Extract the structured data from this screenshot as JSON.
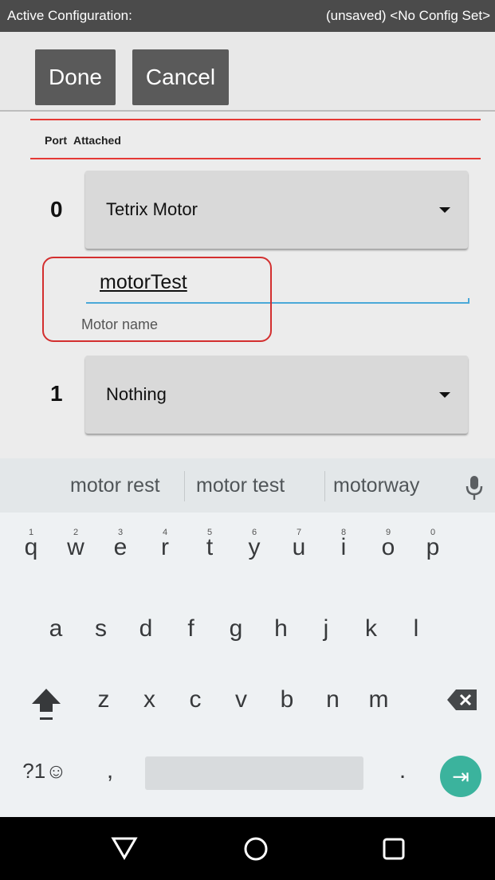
{
  "config_bar": {
    "label": "Active Configuration:",
    "status": "(unsaved) <No Config Set>"
  },
  "actions": {
    "done_label": "Done",
    "cancel_label": "Cancel"
  },
  "table_header": {
    "port": "Port",
    "attached": "Attached"
  },
  "ports": [
    {
      "number": "0",
      "device": "Tetrix Motor"
    },
    {
      "number": "1",
      "device": "Nothing"
    }
  ],
  "motor_name": {
    "value": "motorTest",
    "label": "Motor name"
  },
  "suggestions": [
    "motor rest",
    "motor test",
    "motorway"
  ],
  "keyboard": {
    "row1": [
      "q",
      "w",
      "e",
      "r",
      "t",
      "y",
      "u",
      "i",
      "o",
      "p"
    ],
    "row1_hints": [
      "1",
      "2",
      "3",
      "4",
      "5",
      "6",
      "7",
      "8",
      "9",
      "0"
    ],
    "row2": [
      "a",
      "s",
      "d",
      "f",
      "g",
      "h",
      "j",
      "k",
      "l"
    ],
    "row3": [
      "z",
      "x",
      "c",
      "v",
      "b",
      "n",
      "m"
    ],
    "symbols_label": "?1☺",
    "comma": ",",
    "period": ".",
    "enter_glyph": "⇥"
  },
  "colors": {
    "accent_red": "#e53935",
    "input_underline": "#4aa8d8",
    "enter_key": "#3bb39d"
  }
}
